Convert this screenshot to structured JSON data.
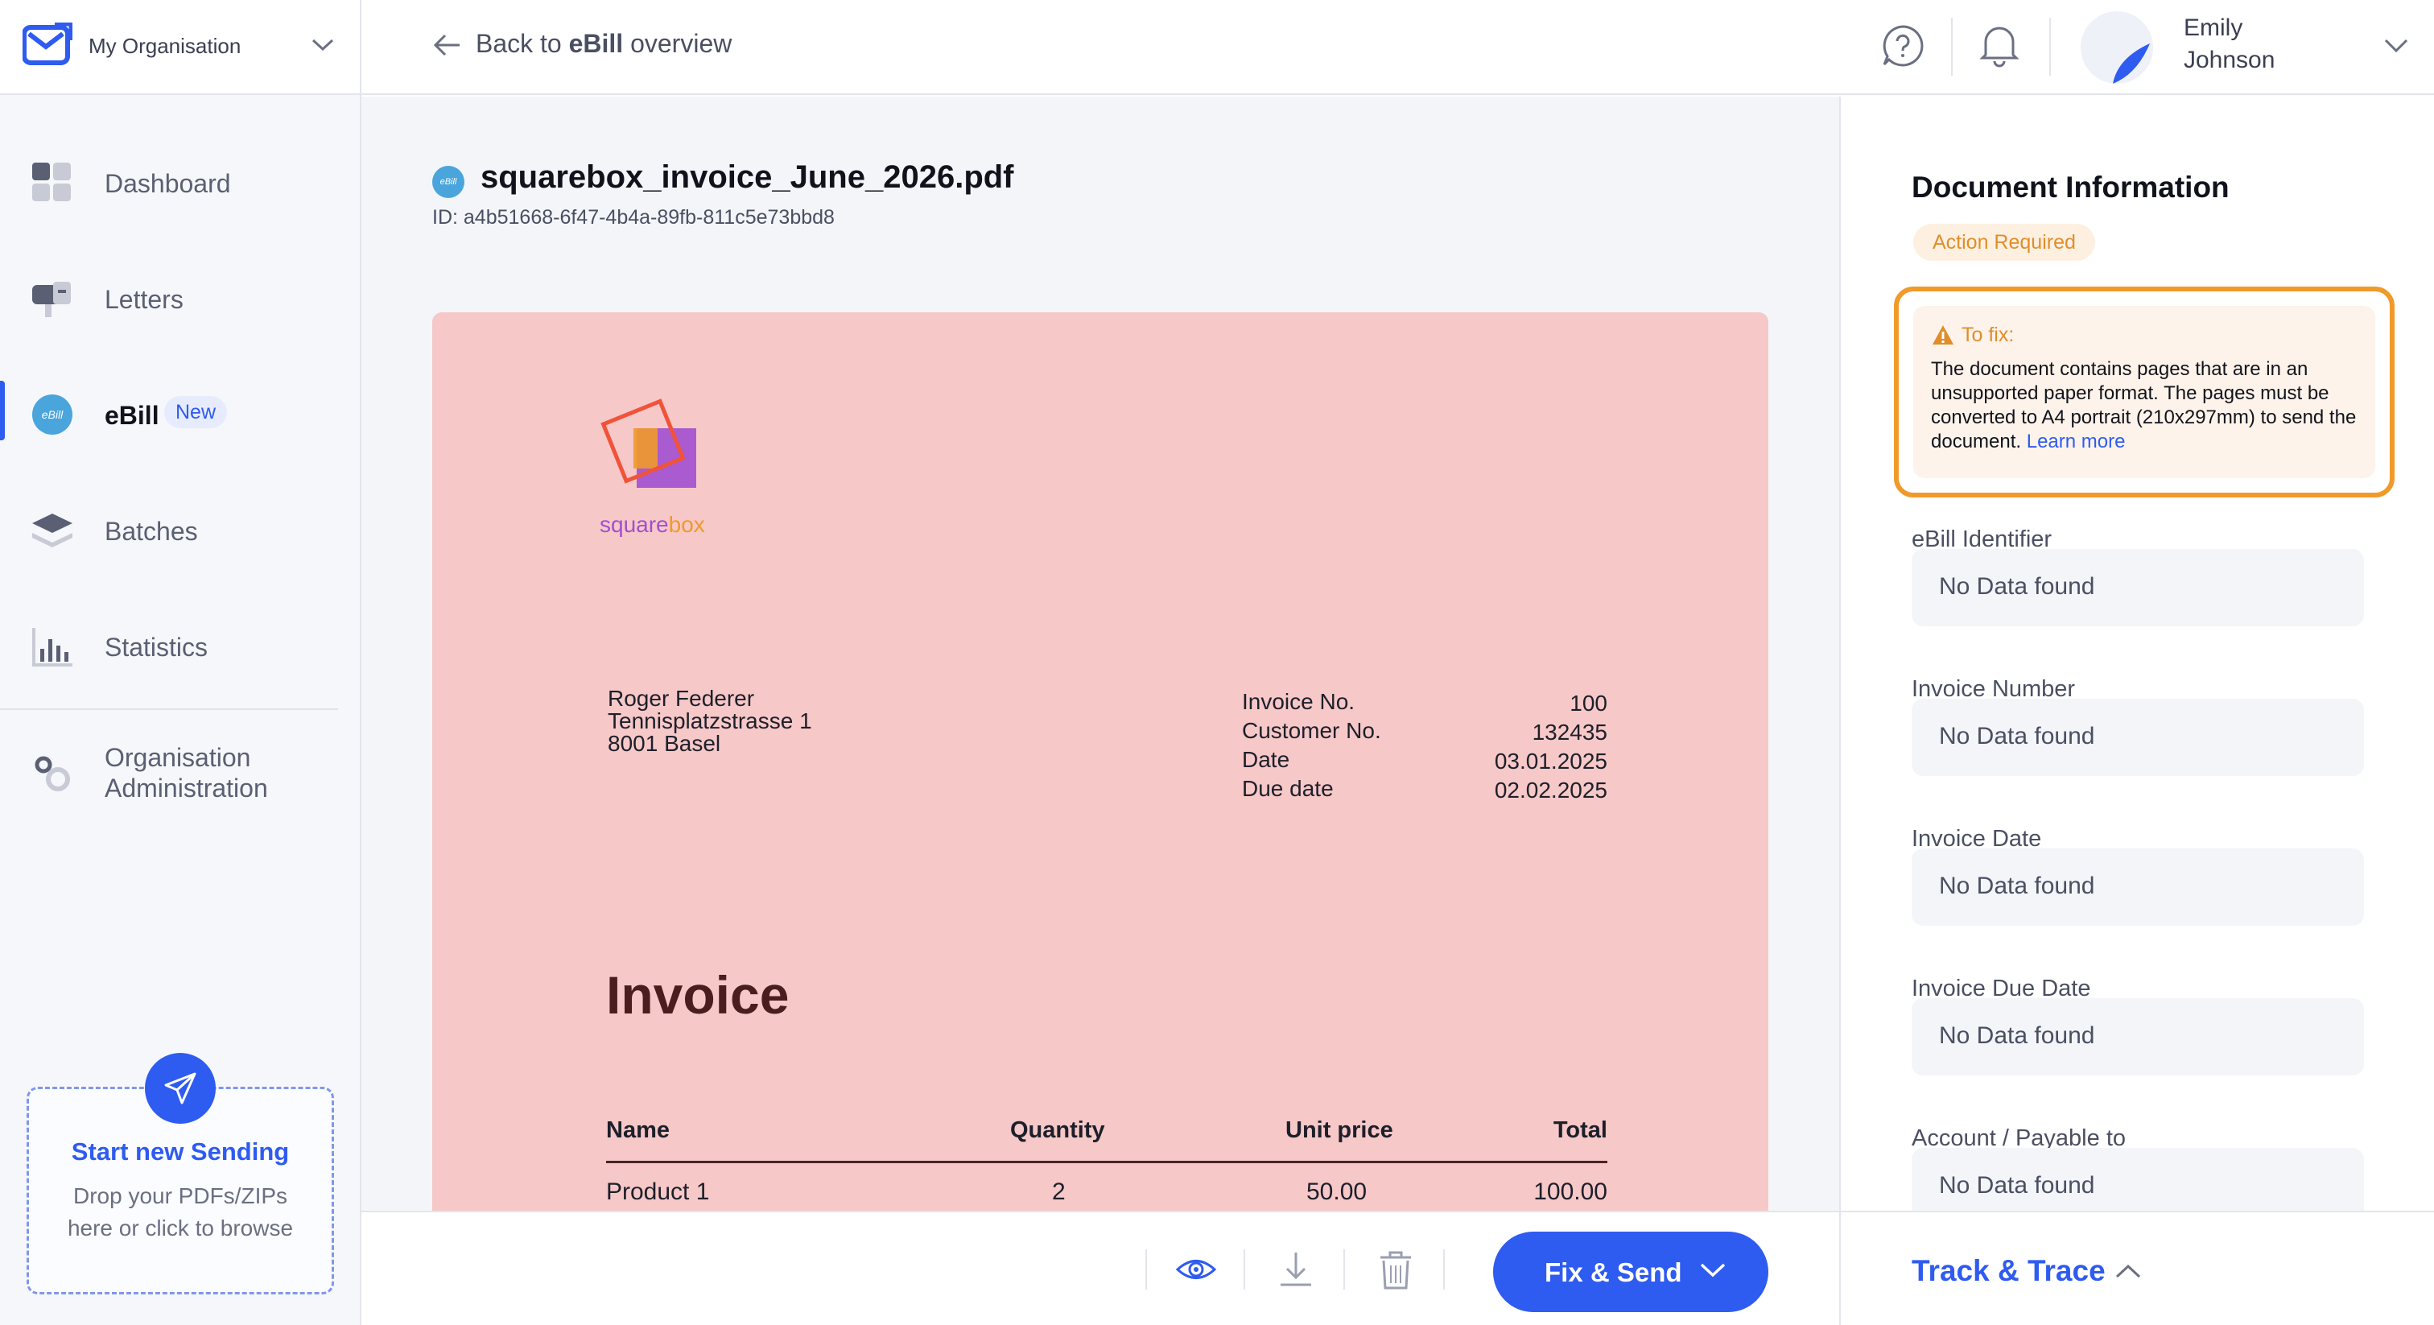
{
  "sidebar": {
    "org_name": "My Organisation",
    "items": [
      {
        "label": "Dashboard"
      },
      {
        "label": "Letters"
      },
      {
        "label": "eBill",
        "badge": "New"
      },
      {
        "label": "Batches"
      },
      {
        "label": "Statistics"
      }
    ],
    "admin": {
      "line1": "Organisation",
      "line2": "Administration"
    },
    "start_sending": {
      "title": "Start new Sending",
      "line1": "Drop your PDFs/ZIPs",
      "line2": "here or click to browse"
    }
  },
  "topbar": {
    "back_prefix": "Back to ",
    "back_bold": "eBill",
    "back_suffix": " overview",
    "user_first": "Emily",
    "user_last": "Johnson"
  },
  "document": {
    "badge_icon": "eBill",
    "filename": "squarebox_invoice_June_2026.pdf",
    "id_text": "ID: a4b51668-6f47-4b4a-89fb-811c5e73bbd8",
    "preview": {
      "logo_word_1": "square",
      "logo_word_2": "box",
      "recipient": [
        "Roger Federer",
        "Tennisplatzstrasse 1",
        "8001 Basel"
      ],
      "meta": [
        {
          "label": "Invoice No.",
          "value": "100"
        },
        {
          "label": "Customer No.",
          "value": "132435"
        },
        {
          "label": "Date",
          "value": "03.01.2025"
        },
        {
          "label": "Due date",
          "value": "02.02.2025"
        }
      ],
      "title": "Invoice",
      "table_headers": [
        "Name",
        "Quantity",
        "Unit price",
        "Total"
      ],
      "rows": [
        [
          "Product 1",
          "2",
          "50.00",
          "100.00"
        ]
      ]
    }
  },
  "actions": {
    "fix_send": "Fix & Send"
  },
  "panel": {
    "title": "Document Information",
    "status": "Action Required",
    "fix_heading": "To fix:",
    "fix_text": "The document contains pages that are in an unsupported paper format. The pages must be converted to A4 portrait (210x297mm) to send the document. ",
    "fix_link": "Learn more",
    "fields": [
      {
        "label": "eBill Identifier",
        "value": "No Data found"
      },
      {
        "label": "Invoice Number",
        "value": "No Data found"
      },
      {
        "label": "Invoice Date",
        "value": "No Data found"
      },
      {
        "label": "Invoice Due Date",
        "value": "No Data found"
      },
      {
        "label": "Account / Payable to",
        "value": "No Data found"
      }
    ],
    "track_trace": "Track & Trace"
  },
  "colors": {
    "accent": "#2e5bf0",
    "warning": "#f09a2a",
    "paper": "#f6c8c8"
  }
}
